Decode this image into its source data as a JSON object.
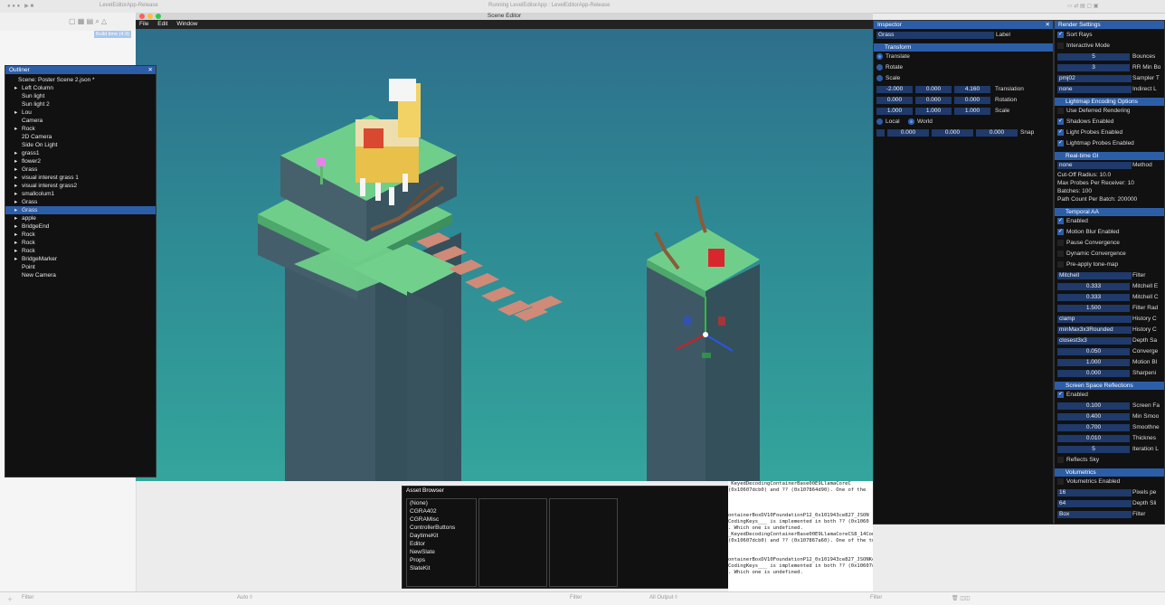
{
  "xcode": {
    "running_status": "Running LevelEditorApp : LevelEditorApp-Release",
    "target_label": "LevelEditorApp-Release",
    "build_badge": "Build time (4.9)",
    "filter_placeholder": "Filter",
    "auto_label": "Auto ◊",
    "output_label": "All Output ◊",
    "filter_placeholder_2": "Filter",
    "filter_placeholder_3": "Filter"
  },
  "scene_editor": {
    "title": "Scene Editor",
    "menu": [
      "File",
      "Edit",
      "Window"
    ]
  },
  "outliner": {
    "title": "Outliner",
    "scene_label": "Scene: Poster Scene 2.json *",
    "items": [
      {
        "label": "Left Column",
        "arrow": true
      },
      {
        "label": "Sun light",
        "arrow": false
      },
      {
        "label": "Sun light 2",
        "arrow": false
      },
      {
        "label": "Lou",
        "arrow": true
      },
      {
        "label": "Camera",
        "arrow": false
      },
      {
        "label": "Rock",
        "arrow": true
      },
      {
        "label": "2D Camera",
        "arrow": false
      },
      {
        "label": "Side On Light",
        "arrow": false
      },
      {
        "label": "grass1",
        "arrow": true
      },
      {
        "label": "flower2",
        "arrow": true
      },
      {
        "label": "Grass",
        "arrow": true
      },
      {
        "label": "visual interest grass 1",
        "arrow": true
      },
      {
        "label": "visual interest grass2",
        "arrow": true
      },
      {
        "label": "smallcolum1",
        "arrow": true
      },
      {
        "label": "Grass",
        "arrow": true
      },
      {
        "label": "Grass",
        "arrow": true,
        "selected": true
      },
      {
        "label": "apple",
        "arrow": true
      },
      {
        "label": "BridgeEnd",
        "arrow": true
      },
      {
        "label": "Rock",
        "arrow": true
      },
      {
        "label": "Rock",
        "arrow": true
      },
      {
        "label": "Rock",
        "arrow": true
      },
      {
        "label": "BridgeMarker",
        "arrow": true
      },
      {
        "label": "Point",
        "arrow": false
      },
      {
        "label": "New Camera",
        "arrow": false
      }
    ]
  },
  "inspector": {
    "title": "Inspector",
    "name_value": "Grass",
    "name_label": "Label",
    "transform_header": "Transform",
    "modes": [
      "Translate",
      "Rotate",
      "Scale"
    ],
    "translation": [
      "-2.000",
      "0.000",
      "4.160"
    ],
    "translation_label": "Translation",
    "rotation": [
      "0.000",
      "0.000",
      "0.000"
    ],
    "rotation_label": "Rotation",
    "scale": [
      "1.000",
      "1.000",
      "1.000"
    ],
    "scale_label": "Scale",
    "local_label": "Local",
    "world_label": "World",
    "snap": [
      "0.000",
      "0.000",
      "0.000"
    ],
    "snap_label": "Snap"
  },
  "render_settings": {
    "title": "Render Settings",
    "sort_rays": "Sort Rays",
    "interactive_mode": "Interactive Mode",
    "bounces_value": "5",
    "bounces_label": "Bounces",
    "rr_value": "3",
    "rr_label": "RR Min Bo",
    "sampler_value": "pmj02",
    "sampler_label": "Sampler T",
    "indirect_value": "none",
    "indirect_label": "Indirect L",
    "lightmap_header": "Lightmap Encoding Options",
    "use_deferred": "Use Deferred Rendering",
    "shadows_enabled": "Shadows Enabled",
    "light_probes": "Light Probes Enabled",
    "lightmap_probes": "Lightmap Probes Enabled",
    "realtime_gi_header": "Real-time GI",
    "method_value": "none",
    "method_label": "Method",
    "cutoff": "Cut-Off Radius: 10.0",
    "max_probes": "Max Probes Per Receiver: 10",
    "batches": "Batches: 100",
    "path_count": "Path Count Per Batch: 200000",
    "temporal_header": "Temporal AA",
    "enabled": "Enabled",
    "motion_blur": "Motion Blur Enabled",
    "pause_conv": "Pause Convergence",
    "dynamic_conv": "Dynamic Convergence",
    "preapply": "Pre-apply tone-map",
    "filter_value": "Mitchell",
    "filter_label": "Filter",
    "mitchell_b": "0.333",
    "mitchell_b_label": "Mitchell E",
    "mitchell_c": "0.333",
    "mitchell_c_label": "Mitchell C",
    "filter_rad": "1.500",
    "filter_rad_label": "Filter Rad",
    "history_c1_value": "clamp",
    "history_c1_label": "History C",
    "history_c2_value": "minMax3x3Rounded",
    "history_c2_label": "History C",
    "depth_value": "closest3x3",
    "depth_label": "Depth Sa",
    "converge_value": "0.050",
    "converge_label": "Converge",
    "motion_value": "1.000",
    "motion_label": "Motion Bl",
    "sharpen_value": "0.000",
    "sharpen_label": "Sharpeni",
    "ssr_header": "Screen Space Reflections",
    "ssr_enabled": "Enabled",
    "screen_fade": "0.100",
    "screen_fade_label": "Screen Fa",
    "min_smooth": "0.400",
    "min_smooth_label": "Min Smoo",
    "smoothness": "0.700",
    "smoothness_label": "Smoothne",
    "thickness": "0.010",
    "thickness_label": "Thicknes",
    "iteration": "5",
    "iteration_label": "Iteration L",
    "reflects_sky": "Reflects Sky",
    "volumetrics_header": "Volumetrics",
    "vol_enabled": "Volumetrics Enabled",
    "pixels_value": "16",
    "pixels_label": "Pixels pe",
    "depth_slices_value": "64",
    "depth_slices_label": "Depth Sli",
    "vol_filter_value": "Box",
    "vol_filter_label": "Filter"
  },
  "asset_browser": {
    "title": "Asset Browser",
    "items": [
      "(None)",
      "CGRA402",
      "CGRAMisc",
      "ControllerButtons",
      "DaytimeKit",
      "Editor",
      "NewSlate",
      "Props",
      "SlateKit"
    ]
  },
  "console": {
    "lines": [
      "_KeyedDecodingContainerBase00E9LlamaCoreC",
      "(0x10607dcb0) and ?? (0x107864d90). One of the",
      "",
      "",
      "",
      "ontainerBoxDV10FoundationP12_0x101943ce827_JSON",
      "CodingKeys___ is implemented in both ?? (0x1060",
      ". Which one is undefined.",
      "_KeyedDecodingContainerBase00E9LlamaCoreCS8_14ComponentArray10CodingKeys__ is",
      "(0x10607dcb0) and ?? (0x107867a60). One of the two will be used. Which one is",
      "",
      "",
      "ontainerBoxDV10FoundationP12_0x101943ce827_JSONKeyedDecodingContainer00E9LlamaCor",
      "CodingKeys___ is implemented in both ?? (0x10607da00) and ?? (0x1078677b0). One",
      ". Which one is undefined."
    ]
  },
  "colors": {
    "accent": "#2c5ea8",
    "panel_bg": "#111111",
    "sky_top": "#2e6f8c",
    "sky_bottom": "#34a59c"
  }
}
